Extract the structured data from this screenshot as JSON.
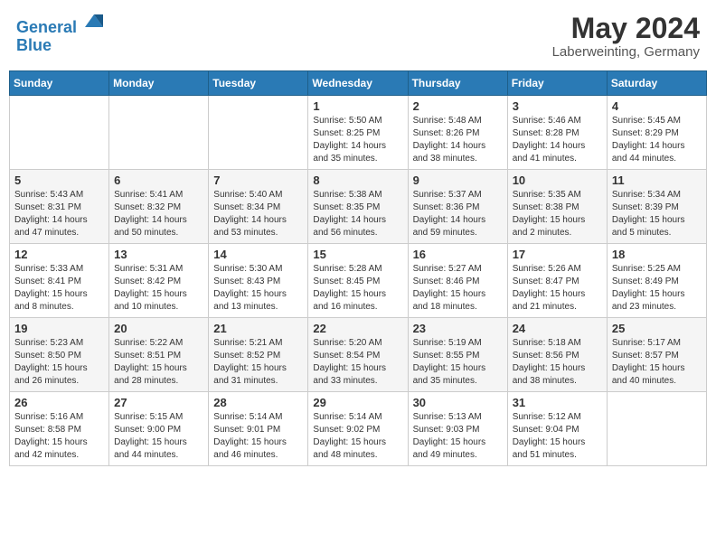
{
  "header": {
    "logo_line1": "General",
    "logo_line2": "Blue",
    "month_year": "May 2024",
    "location": "Laberweinting, Germany"
  },
  "weekdays": [
    "Sunday",
    "Monday",
    "Tuesday",
    "Wednesday",
    "Thursday",
    "Friday",
    "Saturday"
  ],
  "weeks": [
    [
      {
        "date": "",
        "info": ""
      },
      {
        "date": "",
        "info": ""
      },
      {
        "date": "",
        "info": ""
      },
      {
        "date": "1",
        "info": "Sunrise: 5:50 AM\nSunset: 8:25 PM\nDaylight: 14 hours\nand 35 minutes."
      },
      {
        "date": "2",
        "info": "Sunrise: 5:48 AM\nSunset: 8:26 PM\nDaylight: 14 hours\nand 38 minutes."
      },
      {
        "date": "3",
        "info": "Sunrise: 5:46 AM\nSunset: 8:28 PM\nDaylight: 14 hours\nand 41 minutes."
      },
      {
        "date": "4",
        "info": "Sunrise: 5:45 AM\nSunset: 8:29 PM\nDaylight: 14 hours\nand 44 minutes."
      }
    ],
    [
      {
        "date": "5",
        "info": "Sunrise: 5:43 AM\nSunset: 8:31 PM\nDaylight: 14 hours\nand 47 minutes."
      },
      {
        "date": "6",
        "info": "Sunrise: 5:41 AM\nSunset: 8:32 PM\nDaylight: 14 hours\nand 50 minutes."
      },
      {
        "date": "7",
        "info": "Sunrise: 5:40 AM\nSunset: 8:34 PM\nDaylight: 14 hours\nand 53 minutes."
      },
      {
        "date": "8",
        "info": "Sunrise: 5:38 AM\nSunset: 8:35 PM\nDaylight: 14 hours\nand 56 minutes."
      },
      {
        "date": "9",
        "info": "Sunrise: 5:37 AM\nSunset: 8:36 PM\nDaylight: 14 hours\nand 59 minutes."
      },
      {
        "date": "10",
        "info": "Sunrise: 5:35 AM\nSunset: 8:38 PM\nDaylight: 15 hours\nand 2 minutes."
      },
      {
        "date": "11",
        "info": "Sunrise: 5:34 AM\nSunset: 8:39 PM\nDaylight: 15 hours\nand 5 minutes."
      }
    ],
    [
      {
        "date": "12",
        "info": "Sunrise: 5:33 AM\nSunset: 8:41 PM\nDaylight: 15 hours\nand 8 minutes."
      },
      {
        "date": "13",
        "info": "Sunrise: 5:31 AM\nSunset: 8:42 PM\nDaylight: 15 hours\nand 10 minutes."
      },
      {
        "date": "14",
        "info": "Sunrise: 5:30 AM\nSunset: 8:43 PM\nDaylight: 15 hours\nand 13 minutes."
      },
      {
        "date": "15",
        "info": "Sunrise: 5:28 AM\nSunset: 8:45 PM\nDaylight: 15 hours\nand 16 minutes."
      },
      {
        "date": "16",
        "info": "Sunrise: 5:27 AM\nSunset: 8:46 PM\nDaylight: 15 hours\nand 18 minutes."
      },
      {
        "date": "17",
        "info": "Sunrise: 5:26 AM\nSunset: 8:47 PM\nDaylight: 15 hours\nand 21 minutes."
      },
      {
        "date": "18",
        "info": "Sunrise: 5:25 AM\nSunset: 8:49 PM\nDaylight: 15 hours\nand 23 minutes."
      }
    ],
    [
      {
        "date": "19",
        "info": "Sunrise: 5:23 AM\nSunset: 8:50 PM\nDaylight: 15 hours\nand 26 minutes."
      },
      {
        "date": "20",
        "info": "Sunrise: 5:22 AM\nSunset: 8:51 PM\nDaylight: 15 hours\nand 28 minutes."
      },
      {
        "date": "21",
        "info": "Sunrise: 5:21 AM\nSunset: 8:52 PM\nDaylight: 15 hours\nand 31 minutes."
      },
      {
        "date": "22",
        "info": "Sunrise: 5:20 AM\nSunset: 8:54 PM\nDaylight: 15 hours\nand 33 minutes."
      },
      {
        "date": "23",
        "info": "Sunrise: 5:19 AM\nSunset: 8:55 PM\nDaylight: 15 hours\nand 35 minutes."
      },
      {
        "date": "24",
        "info": "Sunrise: 5:18 AM\nSunset: 8:56 PM\nDaylight: 15 hours\nand 38 minutes."
      },
      {
        "date": "25",
        "info": "Sunrise: 5:17 AM\nSunset: 8:57 PM\nDaylight: 15 hours\nand 40 minutes."
      }
    ],
    [
      {
        "date": "26",
        "info": "Sunrise: 5:16 AM\nSunset: 8:58 PM\nDaylight: 15 hours\nand 42 minutes."
      },
      {
        "date": "27",
        "info": "Sunrise: 5:15 AM\nSunset: 9:00 PM\nDaylight: 15 hours\nand 44 minutes."
      },
      {
        "date": "28",
        "info": "Sunrise: 5:14 AM\nSunset: 9:01 PM\nDaylight: 15 hours\nand 46 minutes."
      },
      {
        "date": "29",
        "info": "Sunrise: 5:14 AM\nSunset: 9:02 PM\nDaylight: 15 hours\nand 48 minutes."
      },
      {
        "date": "30",
        "info": "Sunrise: 5:13 AM\nSunset: 9:03 PM\nDaylight: 15 hours\nand 49 minutes."
      },
      {
        "date": "31",
        "info": "Sunrise: 5:12 AM\nSunset: 9:04 PM\nDaylight: 15 hours\nand 51 minutes."
      },
      {
        "date": "",
        "info": ""
      }
    ]
  ]
}
